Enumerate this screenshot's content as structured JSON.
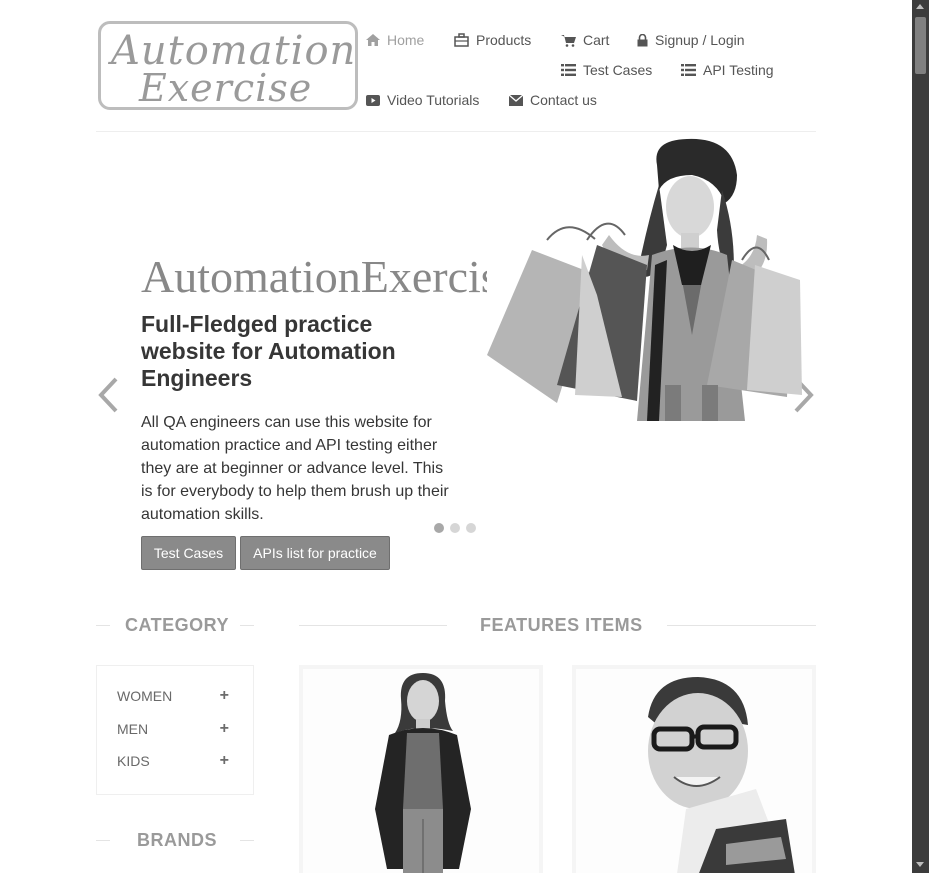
{
  "logo": {
    "line1": "Automation",
    "line2": "Exercise"
  },
  "nav": {
    "home": "Home",
    "products": "Products",
    "cart": "Cart",
    "signup_login": "Signup / Login",
    "test_cases": "Test Cases",
    "api_testing": "API Testing",
    "video_tutorials": "Video Tutorials",
    "contact_us": "Contact us"
  },
  "slider": {
    "brand": "AutomationExercise",
    "heading": "Full-Fledged practice website for Automation Engineers",
    "text": "All QA engineers can use this website for automation practice and API testing either they are at beginner or advance level. This is for everybody to help them brush up their automation skills.",
    "test_cases_button": "Test Cases",
    "apis_button": "APIs list for practice",
    "active_slide": 1,
    "slide_count": 3
  },
  "category": {
    "title": "CATEGORY",
    "items": [
      {
        "label": "WOMEN"
      },
      {
        "label": "MEN"
      },
      {
        "label": "KIDS"
      }
    ]
  },
  "brands": {
    "title": "BRANDS"
  },
  "features": {
    "title": "FEATURES ITEMS"
  },
  "icons": {
    "home": "home-icon",
    "products": "shopping-bag-icon",
    "cart": "cart-icon",
    "signup": "lock-icon",
    "test_cases": "list-icon",
    "api_testing": "list-icon",
    "video": "youtube-play-icon",
    "contact": "envelope-icon",
    "prev": "chevron-left-icon",
    "next": "chevron-right-icon",
    "expand": "plus-icon"
  },
  "colors": {
    "button": "#8a8a8a",
    "text": "#363636",
    "muted": "#9a9a9a",
    "scrollbar": "#3c3c3c"
  }
}
